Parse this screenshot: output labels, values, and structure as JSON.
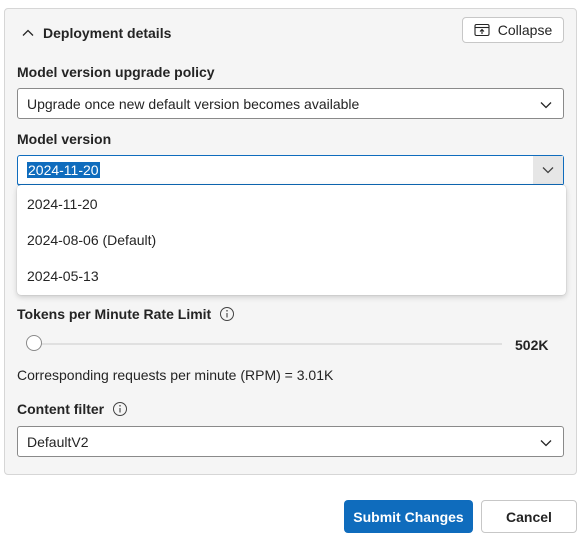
{
  "section": {
    "title": "Deployment details",
    "collapse_label": "Collapse"
  },
  "upgrade_policy": {
    "label": "Model version upgrade policy",
    "value": "Upgrade once new default version becomes available"
  },
  "model_version": {
    "label": "Model version",
    "value": "2024-11-20",
    "options": [
      "2024-11-20",
      "2024-08-06 (Default)",
      "2024-05-13"
    ]
  },
  "rate_limit": {
    "label": "Tokens per Minute Rate Limit",
    "value_label": "502K",
    "slider_fraction": 0.0,
    "rpm_text": "Corresponding requests per minute (RPM) = 3.01K"
  },
  "content_filter": {
    "label": "Content filter",
    "value": "DefaultV2"
  },
  "actions": {
    "submit_label": "Submit Changes",
    "cancel_label": "Cancel"
  },
  "icons": {
    "toggle": "chevron-up-icon",
    "collapse": "collapse-panel-icon",
    "info": "info-icon",
    "dropdown": "chevron-down-icon"
  },
  "colors": {
    "accent": "#0f6cbd",
    "panel_bg": "#f5f5f5"
  }
}
